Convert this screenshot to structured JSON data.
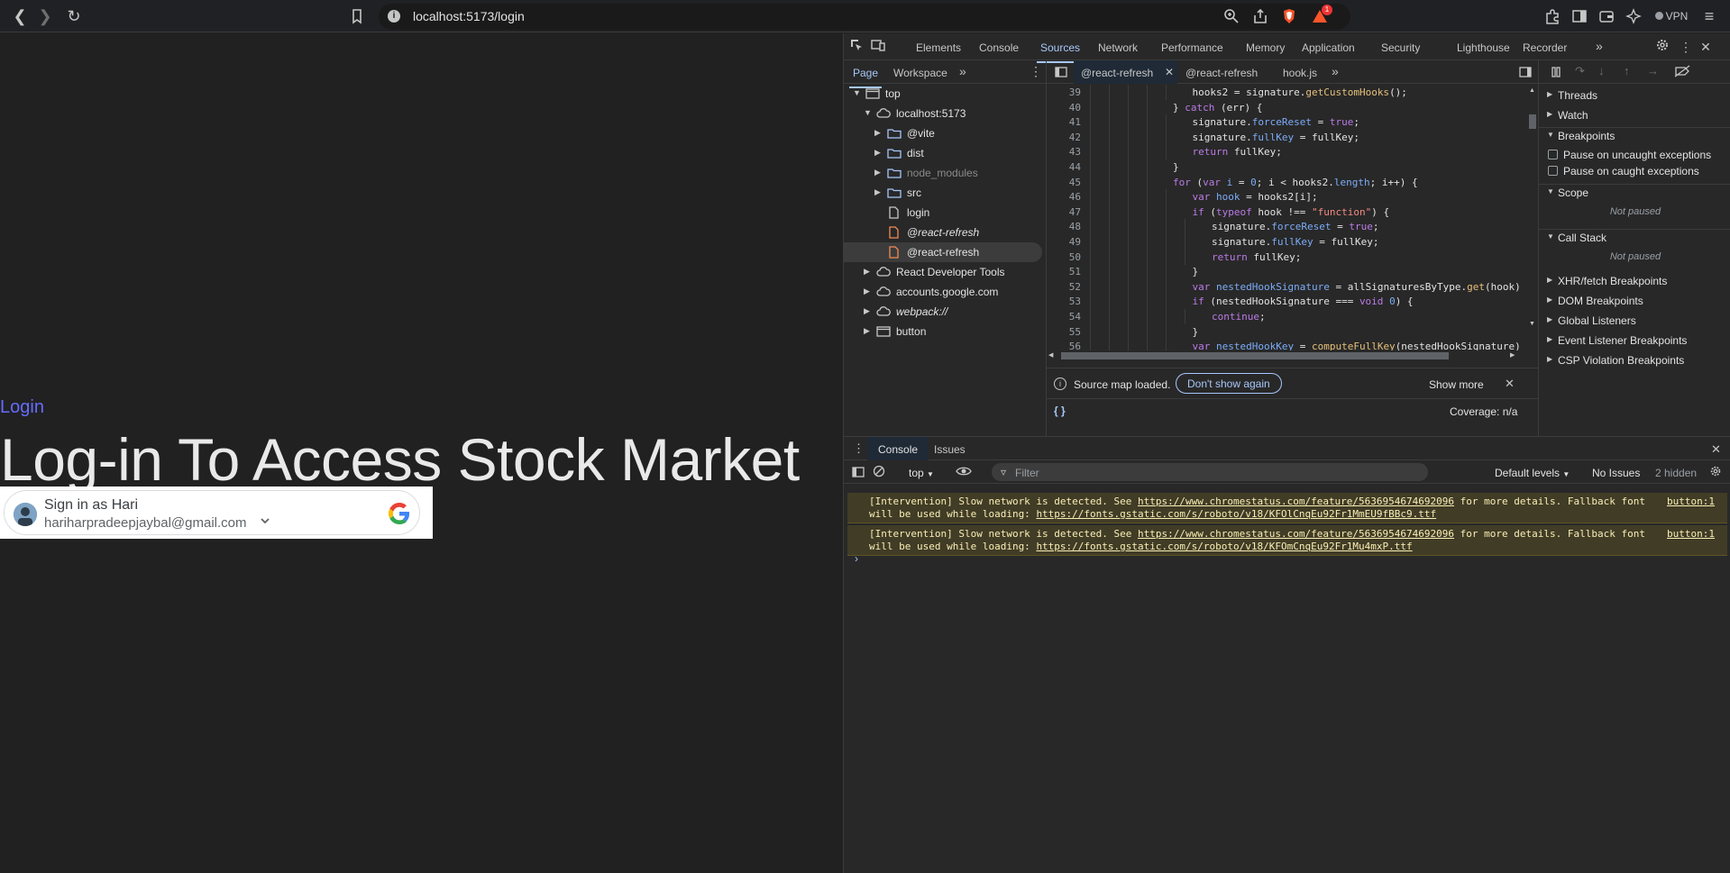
{
  "browser": {
    "url": "localhost:5173/login",
    "vpn_label": "VPN",
    "badge_count": "1"
  },
  "page": {
    "login_link": "Login",
    "headline": "Log-in To Access Stock Market",
    "google_signin": {
      "title": "Sign in as Hari",
      "email": "hariharpradeepjaybal@gmail.com"
    }
  },
  "devtools": {
    "tabs": [
      "Elements",
      "Console",
      "Sources",
      "Network",
      "Performance",
      "Memory",
      "Application",
      "Security",
      "Lighthouse",
      "Recorder"
    ],
    "active_tab": "Sources",
    "navigator_tabs": [
      "Page",
      "Workspace"
    ],
    "tree": [
      {
        "label": "top",
        "icon": "frame-icon",
        "depth": 0,
        "expanded": true
      },
      {
        "label": "localhost:5173",
        "icon": "cloud-icon",
        "depth": 1,
        "expanded": true
      },
      {
        "label": "@vite",
        "icon": "folder-icon",
        "depth": 2,
        "expanded": false
      },
      {
        "label": "dist",
        "icon": "folder-icon",
        "depth": 2,
        "expanded": false
      },
      {
        "label": "node_modules",
        "icon": "folder-icon",
        "depth": 2,
        "expanded": false,
        "dim": true
      },
      {
        "label": "src",
        "icon": "folder-icon",
        "depth": 2,
        "expanded": false
      },
      {
        "label": "login",
        "icon": "file-icon",
        "depth": 2
      },
      {
        "label": "@react-refresh",
        "icon": "file-orange-icon",
        "depth": 2,
        "italic": true
      },
      {
        "label": "@react-refresh",
        "icon": "file-orange-icon",
        "depth": 2,
        "selected": true
      },
      {
        "label": "React Developer Tools",
        "icon": "cloud-icon",
        "depth": 1,
        "expanded": false
      },
      {
        "label": "accounts.google.com",
        "icon": "cloud-icon",
        "depth": 1,
        "expanded": false
      },
      {
        "label": "webpack://",
        "icon": "cloud-icon",
        "depth": 1,
        "expanded": false,
        "italic": true
      },
      {
        "label": "button",
        "icon": "frame-icon",
        "depth": 1,
        "expanded": false
      }
    ],
    "editor_tabs": [
      "@react-refresh",
      "@react-refresh",
      "hook.js"
    ],
    "code_lines": [
      {
        "n": "39",
        "indent": 5,
        "html": "hooks2 = signature.<span class=\"fn\">getCustomHooks</span>();"
      },
      {
        "n": "40",
        "indent": 4,
        "html": "} <span class=\"kw\">catch</span> (err) {"
      },
      {
        "n": "41",
        "indent": 5,
        "html": "signature.<span class=\"pr\">forceReset</span> = <span class=\"kw\">true</span>;"
      },
      {
        "n": "42",
        "indent": 5,
        "html": "signature.<span class=\"pr\">fullKey</span> = fullKey;"
      },
      {
        "n": "43",
        "indent": 5,
        "html": "<span class=\"kw\">return</span> fullKey;"
      },
      {
        "n": "44",
        "indent": 4,
        "html": "}"
      },
      {
        "n": "45",
        "indent": 4,
        "html": "<span class=\"kw\">for</span> (<span class=\"kw\">var</span> <span class=\"pr\">i</span> = <span class=\"pr\">0</span>; i &lt; hooks2.<span class=\"pr\">length</span>; i++) {"
      },
      {
        "n": "46",
        "indent": 5,
        "html": "<span class=\"kw\">var</span> <span class=\"pr\">hook</span> = hooks2[i];"
      },
      {
        "n": "47",
        "indent": 5,
        "html": "<span class=\"kw\">if</span> (<span class=\"kw\">typeof</span> hook !== <span class=\"st\">\"function\"</span>) {"
      },
      {
        "n": "48",
        "indent": 6,
        "html": "signature.<span class=\"pr\">forceReset</span> = <span class=\"kw\">true</span>;"
      },
      {
        "n": "49",
        "indent": 6,
        "html": "signature.<span class=\"pr\">fullKey</span> = fullKey;"
      },
      {
        "n": "50",
        "indent": 6,
        "html": "<span class=\"kw\">return</span> fullKey;"
      },
      {
        "n": "51",
        "indent": 5,
        "html": "}"
      },
      {
        "n": "52",
        "indent": 5,
        "html": "<span class=\"kw\">var</span> <span class=\"pr\">nestedHookSignature</span> = allSignaturesByType.<span class=\"fn\">get</span>(hook)"
      },
      {
        "n": "53",
        "indent": 5,
        "html": "<span class=\"kw\">if</span> (nestedHookSignature === <span class=\"kw\">void</span> <span class=\"pr\">0</span>) {"
      },
      {
        "n": "54",
        "indent": 6,
        "html": "<span class=\"kw\">continue</span>;"
      },
      {
        "n": "55",
        "indent": 5,
        "html": "}"
      },
      {
        "n": "56",
        "indent": 5,
        "html": "<span class=\"kw\">var</span> <span class=\"pr\">nestedHookKey</span> = <span class=\"fn\">computeFullKey</span>(nestedHookSignature)"
      }
    ],
    "source_map_text": "Source map loaded.",
    "dont_show_again": "Don't show again",
    "show_more": "Show more",
    "coverage": "Coverage: n/a",
    "debugger": {
      "threads": "Threads",
      "watch": "Watch",
      "breakpoints": "Breakpoints",
      "pause_uncaught": "Pause on uncaught exceptions",
      "pause_caught": "Pause on caught exceptions",
      "scope": "Scope",
      "not_paused": "Not paused",
      "call_stack": "Call Stack",
      "xhr": "XHR/fetch Breakpoints",
      "dom": "DOM Breakpoints",
      "global": "Global Listeners",
      "event": "Event Listener Breakpoints",
      "csp": "CSP Violation Breakpoints"
    },
    "drawer": {
      "tabs": [
        "Console",
        "Issues"
      ],
      "context": "top",
      "filter_placeholder": "Filter",
      "levels": "Default levels",
      "no_issues": "No Issues",
      "hidden": "2 hidden",
      "messages": [
        {
          "text1": "[Intervention] Slow network is detected. See ",
          "link1": "https://www.chromestatus.com/feature/5636954674692096",
          "text2": " for more details. Fallback font",
          "text3": "will be used while loading: ",
          "link2": "https://fonts.gstatic.com/s/roboto/v18/KFOlCnqEu92Fr1MmEU9fBBc9.ttf",
          "source": "button:1"
        },
        {
          "text1": "[Intervention] Slow network is detected. See ",
          "link1": "https://www.chromestatus.com/feature/5636954674692096",
          "text2": " for more details. Fallback font",
          "text3": "will be used while loading: ",
          "link2": "https://fonts.gstatic.com/s/roboto/v18/KFOmCnqEu92Fr1Mu4mxP.ttf",
          "source": "button:1"
        }
      ]
    }
  }
}
